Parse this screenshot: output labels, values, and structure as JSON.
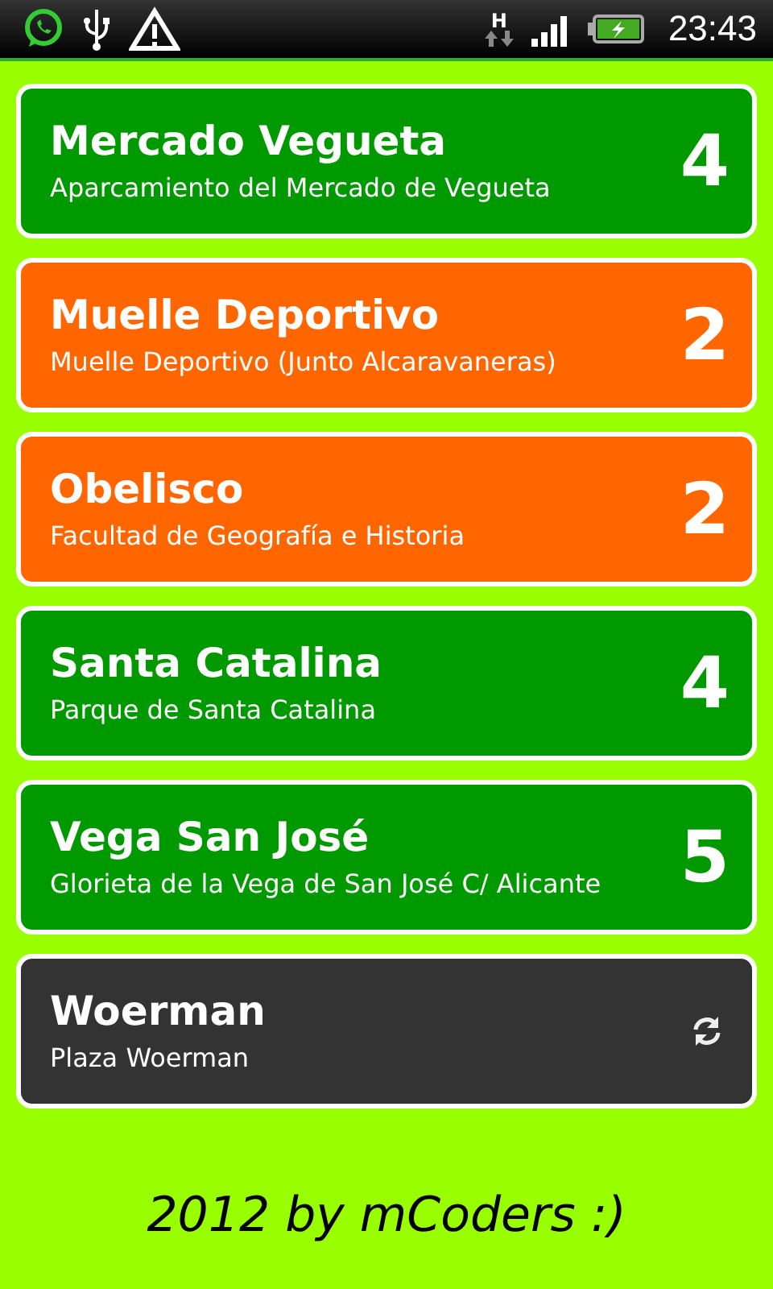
{
  "status_bar": {
    "time": "23:43",
    "network_type": "H"
  },
  "parkings": [
    {
      "name": "Mercado Vegueta",
      "address": "Aparcamiento del Mercado de Vegueta",
      "kind": "count",
      "free": "4",
      "color": "#009900"
    },
    {
      "name": "Muelle Deportivo",
      "address": "Muelle Deportivo (Junto Alcaravaneras)",
      "kind": "count",
      "free": "2",
      "color": "#ff6600"
    },
    {
      "name": "Obelisco",
      "address": "Facultad de Geografía e Historia",
      "kind": "count",
      "free": "2",
      "color": "#ff6600"
    },
    {
      "name": "Santa Catalina",
      "address": "Parque de Santa Catalina",
      "kind": "count",
      "free": "4",
      "color": "#009900"
    },
    {
      "name": "Vega San José",
      "address": "Glorieta de la Vega de San José C/ Alicante",
      "kind": "count",
      "free": "5",
      "color": "#009900"
    },
    {
      "name": "Woerman",
      "address": "Plaza Woerman",
      "kind": "loading",
      "color": "#333333"
    }
  ],
  "footer": "2012 by mCoders :)"
}
